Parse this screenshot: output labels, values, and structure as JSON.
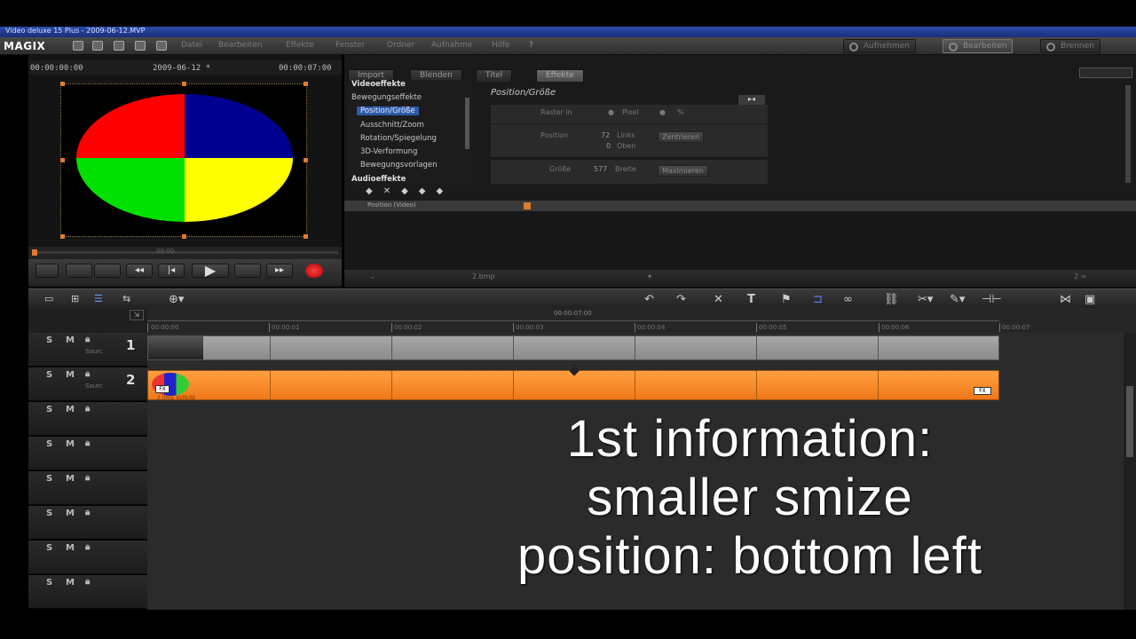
{
  "window": {
    "title": "Video deluxe 15 Plus - 2009-06-12.MVP"
  },
  "menubar": {
    "logo": "MAGIX",
    "menu_items": [
      "Datei",
      "Bearbeiten",
      "Effekte",
      "Fenster",
      "Ordner",
      "Aufnahme",
      "Hilfe"
    ],
    "modes": [
      "Aufnehmen",
      "Bearbeiten",
      "Brennen"
    ],
    "active_mode": "Bearbeiten"
  },
  "preview": {
    "timecode_left": "00:00:00:00",
    "project_name": "2009-06-12 *",
    "timecode_right": "00:00:07:00",
    "pie_colors": [
      "#ff0000",
      "#000090",
      "#00e000",
      "#ffff00"
    ],
    "scrub_timecode": "00:00"
  },
  "effects": {
    "tabs": [
      "Import",
      "Blenden",
      "Titel",
      "Effekte"
    ],
    "active_tab": "Effekte",
    "tree": {
      "header": "Videoeffekte",
      "group": "Bewegungseffekte",
      "items": [
        "Position/Größe",
        "Ausschnitt/Zoom",
        "Rotation/Spiegelung",
        "3D-Verformung",
        "Bewegungsvorlagen"
      ],
      "selected": "Position/Größe",
      "footer": "Audioeffekte"
    },
    "settings": {
      "title": "Position/Größe",
      "raster_label": "Raster in",
      "raster_unit": "Pixel",
      "raster_pct": "%",
      "position_label": "Position",
      "position_x": "72",
      "position_x_label": "Links",
      "position_y": "0",
      "position_y_label": "Oben",
      "center_button": "Zentrieren",
      "size_label": "Größe",
      "size_value": "577",
      "size_unit": "Breite",
      "maximize_button": "Maximieren"
    },
    "keyframe_label": "Position (Video)",
    "footer_file": "2.bmp",
    "footer_right": "2 ∞"
  },
  "timeline": {
    "ruler_marker": "00:00:07:00",
    "ticks": [
      "00:00:00",
      "00:00:01",
      "00:00:02",
      "00:00:03",
      "00:00:04",
      "00:00:05",
      "00:00:06",
      "00:00:07"
    ],
    "tracks": [
      {
        "s": "S",
        "m": "M",
        "num": "1",
        "label": "Sourc"
      },
      {
        "s": "S",
        "m": "M",
        "num": "2",
        "label": "Sourc"
      },
      {
        "s": "S",
        "m": "M",
        "num": "",
        "label": ""
      },
      {
        "s": "S",
        "m": "M",
        "num": "",
        "label": ""
      },
      {
        "s": "S",
        "m": "M",
        "num": "",
        "label": ""
      },
      {
        "s": "S",
        "m": "M",
        "num": "",
        "label": ""
      },
      {
        "s": "S",
        "m": "M",
        "num": "",
        "label": ""
      },
      {
        "s": "S",
        "m": "M",
        "num": "",
        "label": ""
      }
    ],
    "clip2_label": "2.bmp Vollbild",
    "clip2_badge": "FX"
  },
  "caption": {
    "line1": "1st information:",
    "line2": "smaller smize",
    "line3": "position: bottom left"
  }
}
